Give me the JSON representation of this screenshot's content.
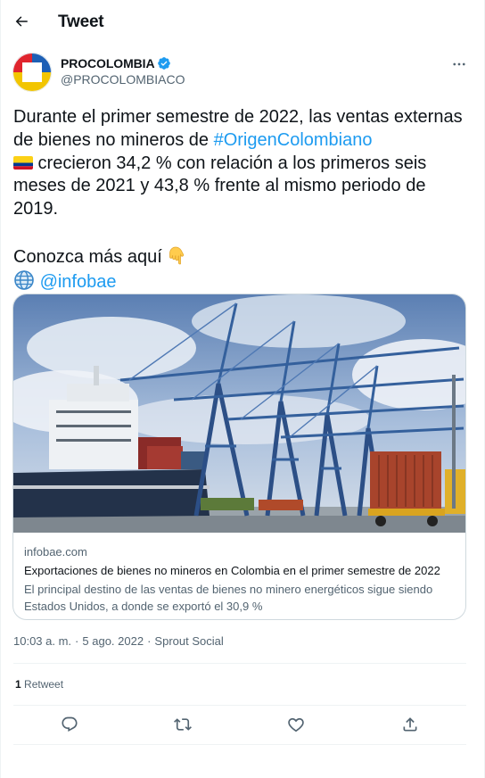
{
  "header": {
    "title": "Tweet",
    "back_icon": "arrow-left-icon"
  },
  "author": {
    "name": "PROCOLOMBIA",
    "handle": "@PROCOLOMBIACO",
    "verified_icon": "verified-badge-icon",
    "avatar_icon": "procolombia-logo",
    "more_icon": "more-horizontal-icon"
  },
  "tweet": {
    "line1": "Durante el primer semestre de 2022, las ventas externas de bienes no mineros de ",
    "hashtag": "#OrigenColombiano",
    "line2": " crecieron 34,2 % con relación a los primeros seis meses de 2021 y 43,8 % frente al mismo periodo de 2019.",
    "cta": "Conozca más aquí ",
    "mention": "@infobae",
    "flag_icon": "colombia-flag-icon",
    "hand_icon": "pointing-down-hand-icon",
    "globe_icon": "globe-icon"
  },
  "card": {
    "image_icon": "port-cranes-cargo-ship-photo",
    "domain": "infobae.com",
    "title": "Exportaciones de bienes no mineros en Colombia en el primer semestre de 2022",
    "description": "El principal destino de las ventas de bienes no minero energéticos sigue siendo Estados Unidos, a donde se exportó el 30,9 %"
  },
  "meta": {
    "time": "10:03 a. m.",
    "sep1": "·",
    "date": "5 ago. 2022",
    "sep2": "·",
    "source": "Sprout Social"
  },
  "stats": {
    "retweet_count": "1",
    "retweet_label": "Retweet"
  },
  "actions": {
    "reply_icon": "reply-icon",
    "retweet_icon": "retweet-icon",
    "like_icon": "heart-icon",
    "share_icon": "share-icon"
  },
  "colors": {
    "accent": "#1d9bf0",
    "text": "#0f1419",
    "muted": "#536471",
    "border": "#cfd9de"
  }
}
